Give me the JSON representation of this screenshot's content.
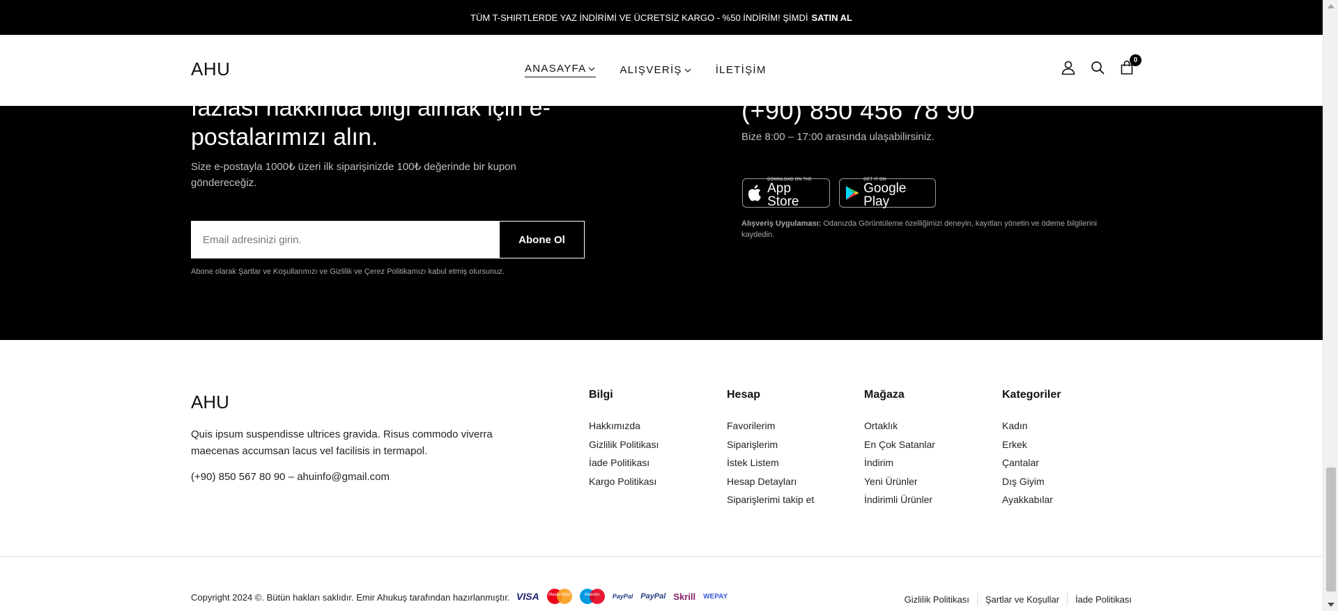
{
  "announcement": {
    "text": "TÜM T-SHIRTLERDE YAZ İNDİRİMİ VE ÜCRETSİZ KARGO - %50 İNDİRİM! ŞİMDİ SATIN AL",
    "cta": "SATIN AL"
  },
  "header": {
    "logo": "AHU",
    "nav": [
      {
        "label": "ANASAYFA",
        "has_dropdown": true,
        "active": true
      },
      {
        "label": "ALIŞVERİŞ",
        "has_dropdown": true,
        "active": false
      },
      {
        "label": "İLETİŞİM",
        "has_dropdown": false,
        "active": false
      }
    ],
    "icons": [
      "user-icon",
      "search-icon",
      "cart-icon"
    ],
    "cart_count": "0"
  },
  "newsletter": {
    "heading": "fazlası hakkında bilgi almak için e-postalarımızı alın.",
    "subtext": "Size e-postayla 1000₺ üzeri ilk siparişinizde 100₺ değerinde bir kupon göndereceğiz.",
    "email_placeholder": "Email adresinizi girin.",
    "subscribe_label": "Abone Ol",
    "terms": "Abone olarak Şartlar ve Koşullarımızı ve Gizlilik ve Çerez Politikamızı kabul etmiş olursunuz.",
    "phone": "(+90) 850 456 78 90",
    "hours": "Bize 8:00 – 17:00 arasında ulaşabilirsiniz.",
    "app_store": {
      "small": "Download on the",
      "big": "App Store"
    },
    "google_play": {
      "small": "GET IT ON",
      "big": "Google Play"
    },
    "app_note_label": "Alışveriş Uygulaması:",
    "app_note": "Odanızda Görüntüleme özelliğimizi deneyin, kayıtları yönetin ve ödeme bilgilerini kaydedin."
  },
  "footer": {
    "logo": "AHU",
    "description": "Quis ipsum suspendisse ultrices gravida. Risus commodo viverra maecenas accumsan lacus vel facilisis in termapol.",
    "contact": "(+90) 850 567 80 90 – ahuinfo@gmail.com",
    "columns": [
      {
        "title": "Bilgi",
        "links": [
          "Hakkımızda",
          "Gizlilik Politikası",
          "İade Politikası",
          "Kargo Politikası"
        ]
      },
      {
        "title": "Hesap",
        "links": [
          "Favorilerim",
          "Siparişlerim",
          "İstek Listem",
          "Hesap Detayları",
          "Siparişlerimi takip et"
        ]
      },
      {
        "title": "Mağaza",
        "links": [
          "Ortaklık",
          "En Çok Satanlar",
          "İndirim",
          "Yeni Ürünler",
          "İndirimli Ürünler"
        ]
      },
      {
        "title": "Kategoriler",
        "links": [
          "Kadın",
          "Erkek",
          "Çantalar",
          "Dış Giyim",
          "Ayakkabılar"
        ]
      }
    ],
    "copyright": "Copyright 2024 ©. Bütün hakları saklıdır. Emir Ahukuş tarafından hazırlanmıştır.",
    "payments": {
      "visa": "VISA",
      "mastercard": "MasterCard",
      "maestro": "Maestro",
      "paypal_small": "PayPal",
      "paypal": "PayPal",
      "skrill": "Skrill",
      "wepay": "WEPAY"
    },
    "legal": [
      "Gizlilik Politikası",
      "Şartlar ve Koşullar",
      "İade Politikası"
    ]
  }
}
